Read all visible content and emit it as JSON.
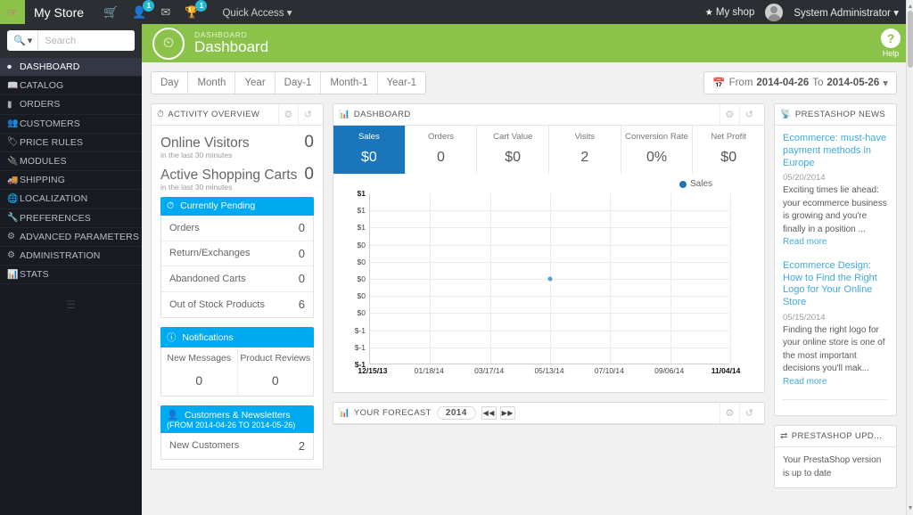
{
  "topbar": {
    "logo_icon": "hand-pointer-icon",
    "store_name": "My Store",
    "icons": [
      {
        "name": "cart-icon",
        "glyph": "☰",
        "badge": ""
      },
      {
        "name": "customers-icon",
        "glyph": "▲",
        "badge": "1"
      },
      {
        "name": "messages-icon",
        "glyph": "✉",
        "badge": ""
      },
      {
        "name": "trophy-icon",
        "glyph": "⚱",
        "badge": "1"
      }
    ],
    "quick_access": "Quick Access",
    "my_shop": "My shop",
    "admin_name": "System Administrator"
  },
  "sidebar": {
    "search_placeholder": "Search",
    "search_button_icon": "search-icon",
    "items": [
      {
        "label": "DASHBOARD",
        "icon": "speedometer-icon",
        "active": true
      },
      {
        "label": "CATALOG",
        "icon": "book-icon",
        "active": false
      },
      {
        "label": "ORDERS",
        "icon": "card-icon",
        "active": false
      },
      {
        "label": "CUSTOMERS",
        "icon": "people-icon",
        "active": false
      },
      {
        "label": "PRICE RULES",
        "icon": "tag-icon",
        "active": false
      },
      {
        "label": "MODULES",
        "icon": "plug-icon",
        "active": false
      },
      {
        "label": "SHIPPING",
        "icon": "truck-icon",
        "active": false
      },
      {
        "label": "LOCALIZATION",
        "icon": "globe-icon",
        "active": false
      },
      {
        "label": "PREFERENCES",
        "icon": "wrench-icon",
        "active": false
      },
      {
        "label": "ADVANCED PARAMETERS",
        "icon": "sliders-icon",
        "active": false
      },
      {
        "label": "ADMINISTRATION",
        "icon": "gear-icon",
        "active": false
      },
      {
        "label": "STATS",
        "icon": "bar-chart-icon",
        "active": false
      }
    ]
  },
  "page_header": {
    "breadcrumb": "DASHBOARD",
    "title": "Dashboard",
    "icon": "dashboard-gauge-icon",
    "help_label": "Help",
    "help_glyph": "?"
  },
  "toolbar": {
    "range_buttons": [
      "Day",
      "Month",
      "Year",
      "Day-1",
      "Month-1",
      "Year-1"
    ],
    "date_range": {
      "prefix": "From",
      "from": "2014-04-26",
      "middle": "To",
      "to": "2014-05-26",
      "icon": "calendar-icon"
    }
  },
  "activity_overview": {
    "title": "ACTIVITY OVERVIEW",
    "title_icon": "clock-icon",
    "tools": [
      "gear-icon",
      "refresh-icon"
    ],
    "online_visitors": {
      "label": "Online Visitors",
      "value": "0",
      "sub": "in the last 30 minutes"
    },
    "active_carts": {
      "label": "Active Shopping Carts",
      "value": "0",
      "sub": "in the last 30 minutes"
    },
    "pending": {
      "heading": "Currently Pending",
      "heading_icon": "clock-icon",
      "rows": [
        {
          "label": "Orders",
          "value": "0"
        },
        {
          "label": "Return/Exchanges",
          "value": "0"
        },
        {
          "label": "Abandoned Carts",
          "value": "0"
        },
        {
          "label": "Out of Stock Products",
          "value": "6"
        }
      ]
    },
    "notifications": {
      "heading": "Notifications",
      "heading_icon": "info-icon",
      "cells": [
        {
          "label": "New Messages",
          "value": "0"
        },
        {
          "label": "Product Reviews",
          "value": "0"
        }
      ]
    },
    "customers": {
      "heading": "Customers & Newsletters",
      "heading_icon": "user-icon",
      "subheading": "(FROM 2014-04-26 TO 2014-05-26)",
      "rows": [
        {
          "label": "New Customers",
          "value": "2"
        }
      ]
    }
  },
  "dashboard_panel": {
    "title": "DASHBOARD",
    "title_icon": "bar-chart-icon",
    "tools": [
      "gear-icon",
      "refresh-icon"
    ],
    "kpis": [
      {
        "label": "Sales",
        "value": "$0",
        "active": true
      },
      {
        "label": "Orders",
        "value": "0",
        "active": false
      },
      {
        "label": "Cart Value",
        "value": "$0",
        "active": false
      },
      {
        "label": "Visits",
        "value": "2",
        "active": false
      },
      {
        "label": "Conversion Rate",
        "value": "0%",
        "active": false
      },
      {
        "label": "Net Profit",
        "value": "$0",
        "active": false
      }
    ]
  },
  "chart_data": {
    "type": "line",
    "title": "",
    "xlabel": "",
    "ylabel": "",
    "legend": [
      {
        "name": "Sales",
        "color": "#2573b5"
      }
    ],
    "legend_position": "top-right",
    "grid": true,
    "ytick_labels": [
      "$1",
      "$1",
      "$1",
      "$0",
      "$0",
      "$0",
      "$0",
      "$0",
      "$-1",
      "$-1",
      "$-1"
    ],
    "ytick_values": [
      1,
      0.8,
      0.6,
      0.4,
      0.2,
      0,
      -0.2,
      -0.4,
      -0.6,
      -0.8,
      -1
    ],
    "ylim": [
      -1,
      1
    ],
    "xtick_labels": [
      "12/15/13",
      "01/18/14",
      "03/17/14",
      "05/13/14",
      "07/10/14",
      "09/06/14",
      "11/04/14"
    ],
    "series": [
      {
        "name": "Sales",
        "color": "#5a9bd0",
        "points": [
          {
            "x": "05/13/14",
            "y": 0
          }
        ]
      }
    ]
  },
  "forecast": {
    "title": "YOUR FORECAST",
    "title_icon": "bar-chart-icon",
    "year": "2014",
    "prev_icon": "fast-backward-icon",
    "next_icon": "fast-forward-icon",
    "tools": [
      "gear-icon",
      "refresh-icon"
    ]
  },
  "news": {
    "title": "PRESTASHOP NEWS",
    "title_icon": "rss-icon",
    "items": [
      {
        "title": "Ecommerce: must-have payment methods in Europe",
        "date": "05/20/2014",
        "text": "Exciting times lie ahead: your ecommerce business is growing and you're finally in a position ...",
        "read_more": "Read more"
      },
      {
        "title": "Ecommerce Design: How to Find the Right Logo for Your Online Store",
        "date": "05/15/2014",
        "text": "Finding the right logo for your online store is one of the most important decisions you'll mak...",
        "read_more": "Read more"
      }
    ]
  },
  "updates": {
    "title": "PRESTASHOP UPD...",
    "title_icon": "retweet-icon",
    "text": "Your PrestaShop version is up to date"
  }
}
